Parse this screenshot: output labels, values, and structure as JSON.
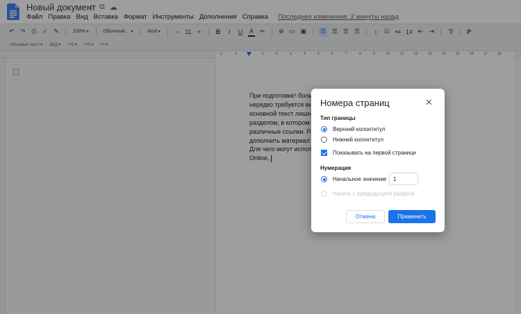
{
  "app": {
    "doc_title": "Новый документ",
    "last_edit": "Последнее изменение: 2 минуты назад",
    "brand_color": "#4285f4",
    "title_icons": [
      "star-icon",
      "folder-move-icon",
      "cloud-status-icon"
    ]
  },
  "menu": {
    "items": [
      "Файл",
      "Правка",
      "Вид",
      "Вставка",
      "Формат",
      "Инструменты",
      "Дополнения",
      "Справка"
    ]
  },
  "toolbar": {
    "zoom": "100%",
    "style": "Обычный…",
    "font": "Arial",
    "font_size": "11",
    "bold": "B",
    "italic": "I",
    "underline": "U",
    "text_color": "A",
    "mode_label": "Р"
  },
  "toolbar2": {
    "style_label": "Обычный текст",
    "font_label": "аБД",
    "btn1": "<•3",
    "btn2": "<•0",
    "btn3": "•••"
  },
  "ruler": {
    "numbers": [
      "2",
      "1",
      "1",
      "2",
      "3",
      "4",
      "5",
      "6",
      "7",
      "8",
      "9",
      "10",
      "11",
      "12",
      "13",
      "14",
      "15",
      "16",
      "17",
      "18"
    ]
  },
  "document": {
    "text": "При подготовке¹ большо… тов,\nнередко требуется внос…\nосновной текст лишне… ельным\nразделом, в котором б… ользуют\nразличные ссылки. Ра… чтобы\nдополнить материал и… втора.\nДля чего могут исполь… ord\nOnline."
  },
  "dialog": {
    "title": "Номера страниц",
    "section_border": "Тип границы",
    "opt_header": "Верхний колонтитул",
    "opt_footer": "Нижний колонтитул",
    "opt_first_page": "Показывать на первой странице",
    "section_numbering": "Нумерация",
    "opt_start_value": "Начальное значение",
    "start_value": "1",
    "opt_continue": "Начать с предыдущего раздела",
    "cancel": "Отмена",
    "apply": "Применить",
    "accent_color": "#1a73e8"
  }
}
